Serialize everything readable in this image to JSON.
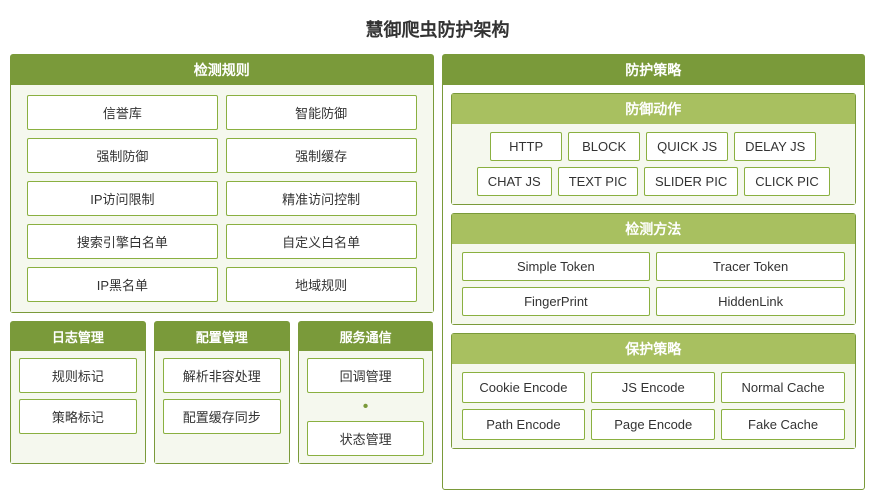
{
  "title": "慧御爬虫防护架构",
  "left": {
    "detection": {
      "header": "检测规则",
      "items": [
        [
          "信誉库",
          "智能防御"
        ],
        [
          "强制防御",
          "强制缓存"
        ],
        [
          "IP访问限制",
          "精准访问控制"
        ],
        [
          "搜索引擎白名单",
          "自定义白名单"
        ],
        [
          "IP黑名单",
          "地域规则"
        ]
      ]
    },
    "bottom": [
      {
        "header": "日志管理",
        "items": [
          "规则标记",
          "策略标记"
        ]
      },
      {
        "header": "配置管理",
        "items": [
          "解析非容处理",
          "配置缓存同步"
        ]
      },
      {
        "header": "服务通信",
        "items": [
          "回调管理",
          "状态管理"
        ],
        "connector": true
      }
    ]
  },
  "right": {
    "protection": {
      "header": "防护策略",
      "defense": {
        "header": "防御动作",
        "rows": [
          [
            "HTTP",
            "BLOCK",
            "QUICK JS",
            "DELAY JS"
          ],
          [
            "CHAT JS",
            "TEXT PIC",
            "SLIDER PIC",
            "CLICK PIC"
          ]
        ]
      },
      "detect_method": {
        "header": "检测方法",
        "items": [
          "Simple Token",
          "Tracer Token",
          "FingerPrint",
          "HiddenLink"
        ]
      },
      "protect_strategy": {
        "header": "保护策略",
        "items": [
          "Cookie Encode",
          "JS Encode",
          "Normal Cache",
          "Path Encode",
          "Page Encode",
          "Fake Cache"
        ]
      }
    }
  }
}
